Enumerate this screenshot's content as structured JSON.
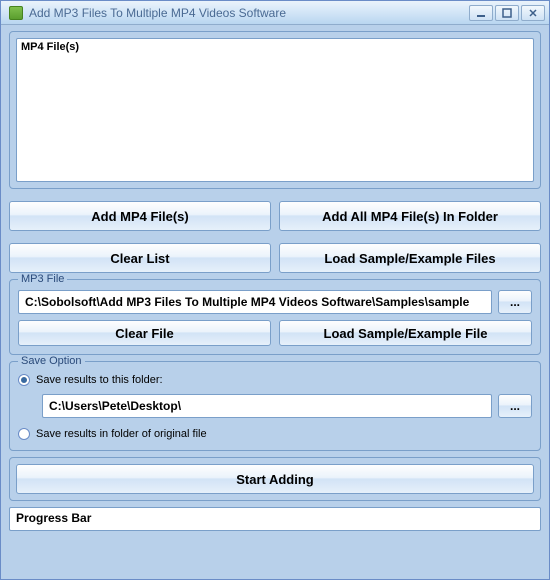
{
  "window": {
    "title": "Add MP3 Files To Multiple MP4 Videos Software"
  },
  "mp4": {
    "list_header": "MP4 File(s)",
    "add_btn": "Add MP4 File(s)",
    "add_all_btn": "Add All MP4 File(s) In Folder",
    "clear_btn": "Clear List",
    "load_sample_btn": "Load Sample/Example Files"
  },
  "mp3": {
    "legend": "MP3 File",
    "path": "C:\\Sobolsoft\\Add MP3 Files To Multiple MP4 Videos Software\\Samples\\sample",
    "browse_btn": "...",
    "clear_btn": "Clear File",
    "load_sample_btn": "Load Sample/Example File"
  },
  "save": {
    "legend": "Save Option",
    "radio1": "Save results to this folder:",
    "radio2": "Save results in folder of original file",
    "folder": "C:\\Users\\Pete\\Desktop\\",
    "browse_btn": "..."
  },
  "start_btn": "Start Adding",
  "progress_label": "Progress Bar"
}
